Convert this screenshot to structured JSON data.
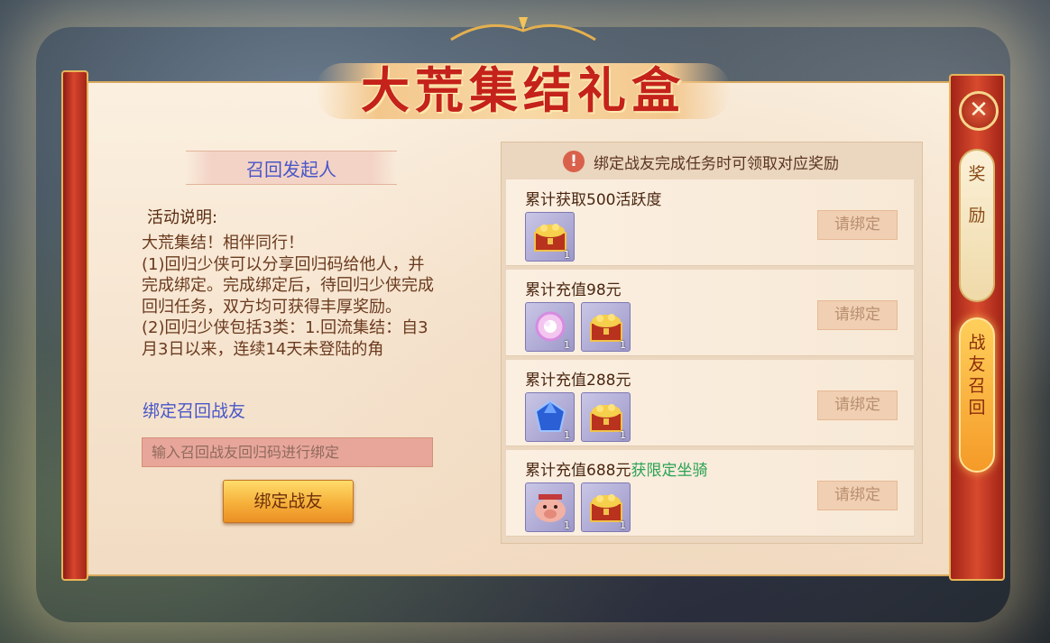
{
  "window": {
    "title": "大荒集结礼盒"
  },
  "left_panel": {
    "subtitle": "召回发起人",
    "desc_label": "活动说明:",
    "desc_text": "大荒集结！相伴同行！\n(1)回归少侠可以分享回归码给他人，并完成绑定。完成绑定后，待回归少侠完成回归任务，双方均可获得丰厚奖励。\n(2)回归少侠包括3类：1.回流集结：自3月3日以来，连续14天未登陆的角",
    "bind_link": "绑定召回战友",
    "input_placeholder": "输入召回战友回归码进行绑定",
    "bind_button": "绑定战友"
  },
  "right_panel": {
    "notice": "绑定战友完成任务时可领取对应奖励",
    "notice_icon": "exclamation-icon",
    "rows": [
      {
        "title": "累计获取500活跃度",
        "extra": "",
        "button": "请绑定",
        "items": [
          {
            "icon": "treasure-chest-icon",
            "qty": "1"
          }
        ]
      },
      {
        "title": "累计充值98元",
        "extra": "",
        "button": "请绑定",
        "items": [
          {
            "icon": "pearl-orb-icon",
            "qty": "1"
          },
          {
            "icon": "treasure-chest-icon",
            "qty": "1"
          }
        ]
      },
      {
        "title": "累计充值288元",
        "extra": "",
        "button": "请绑定",
        "items": [
          {
            "icon": "blue-gem-icon",
            "qty": "1"
          },
          {
            "icon": "treasure-chest-icon",
            "qty": "1"
          }
        ]
      },
      {
        "title": "累计充值688元",
        "extra": "获限定坐骑",
        "button": "请绑定",
        "items": [
          {
            "icon": "pig-mount-icon",
            "qty": "1"
          },
          {
            "icon": "treasure-chest-icon",
            "qty": "1"
          }
        ]
      }
    ]
  },
  "side_tabs": {
    "close_icon": "close-icon",
    "reward": [
      "奖",
      "励"
    ],
    "recall": [
      "战",
      "友",
      "召",
      "回"
    ]
  },
  "colors": {
    "accent_red": "#c4221a",
    "link_blue": "#4856c8",
    "highlight_green": "#2aa254",
    "button_gold": "#f6b03a"
  }
}
